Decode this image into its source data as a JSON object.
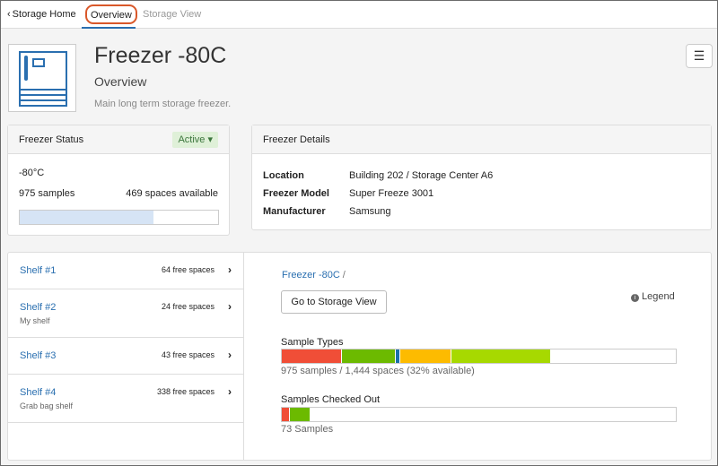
{
  "nav": {
    "back_label": "Storage Home",
    "tabs": [
      {
        "label": "Overview",
        "active": true
      },
      {
        "label": "Storage View",
        "active": false
      }
    ]
  },
  "header": {
    "title": "Freezer -80C",
    "subtitle": "Overview",
    "description": "Main long term storage freezer.",
    "menu_icon": "hamburger-icon"
  },
  "status": {
    "heading": "Freezer Status",
    "badge": "Active",
    "temperature": "-80°C",
    "samples": "975 samples",
    "spaces": "469 spaces available",
    "fill_fraction": 0.675
  },
  "details": {
    "heading": "Freezer Details",
    "rows": [
      {
        "key": "Location",
        "value": "Building 202 / Storage Center A6"
      },
      {
        "key": "Freezer Model",
        "value": "Super Freeze 3001"
      },
      {
        "key": "Manufacturer",
        "value": "Samsung"
      }
    ]
  },
  "shelves": [
    {
      "name": "Shelf #1",
      "free": "64 free spaces",
      "desc": ""
    },
    {
      "name": "Shelf #2",
      "free": "24 free spaces",
      "desc": "My shelf"
    },
    {
      "name": "Shelf #3",
      "free": "43 free spaces",
      "desc": ""
    },
    {
      "name": "Shelf #4",
      "free": "338 free spaces",
      "desc": "Grab bag shelf"
    }
  ],
  "storage_panel": {
    "breadcrumb_link": "Freezer -80C",
    "breadcrumb_sep": "/",
    "goto_button": "Go to Storage View",
    "legend_label": "Legend",
    "sample_types_label": "Sample Types",
    "sample_types_note": "975 samples / 1,444 spaces (32% available)",
    "sample_types_segments": [
      {
        "fraction": 0.152,
        "color": "#f04e37"
      },
      {
        "fraction": 0.138,
        "color": "#6cba00"
      },
      {
        "fraction": 0.011,
        "color": "#1a6fa8"
      },
      {
        "fraction": 0.129,
        "color": "#fdbb00"
      },
      {
        "fraction": 0.25,
        "color": "#a7d900"
      }
    ],
    "checked_out_label": "Samples Checked Out",
    "checked_out_note": "73 Samples",
    "checked_out_segments": [
      {
        "fraction": 0.02,
        "color": "#f04e37"
      },
      {
        "fraction": 0.05,
        "color": "#6cba00"
      }
    ]
  },
  "colors": {
    "accent": "#2a6fb0",
    "active_badge_bg": "#dff0d8",
    "active_badge_text": "#3c763d",
    "highlight_circle": "#d9582a"
  }
}
